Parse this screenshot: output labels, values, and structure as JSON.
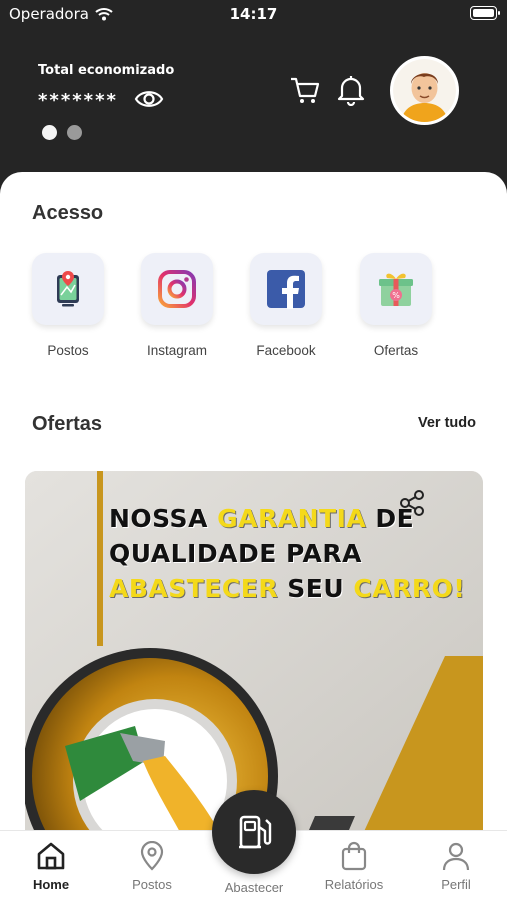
{
  "status_bar": {
    "carrier": "Operadora",
    "time": "14:17"
  },
  "header": {
    "saved_label": "Total economizado",
    "saved_value": "*******"
  },
  "access": {
    "title": "Acesso",
    "items": [
      {
        "label": "Postos",
        "icon": "map-pin-icon"
      },
      {
        "label": "Instagram",
        "icon": "instagram-icon"
      },
      {
        "label": "Facebook",
        "icon": "facebook-icon"
      },
      {
        "label": "Ofertas",
        "icon": "gift-icon"
      }
    ]
  },
  "offers": {
    "title": "Ofertas",
    "see_all": "Ver tudo",
    "banner": {
      "line1a": "NOSSA ",
      "line1b": "GARANTIA",
      "line1c": " DE",
      "line2": "QUALIDADE PARA",
      "line3a": "ABASTECER",
      "line3b": " SEU ",
      "line3c": "CARRO!"
    }
  },
  "bottom_nav": {
    "items": [
      {
        "label": "Home"
      },
      {
        "label": "Postos"
      },
      {
        "label": "Abastecer"
      },
      {
        "label": "Relatórios"
      },
      {
        "label": "Perfil"
      }
    ]
  },
  "colors": {
    "header_bg": "#252525",
    "accent": "#c8961e",
    "highlight": "#f4d91a"
  }
}
